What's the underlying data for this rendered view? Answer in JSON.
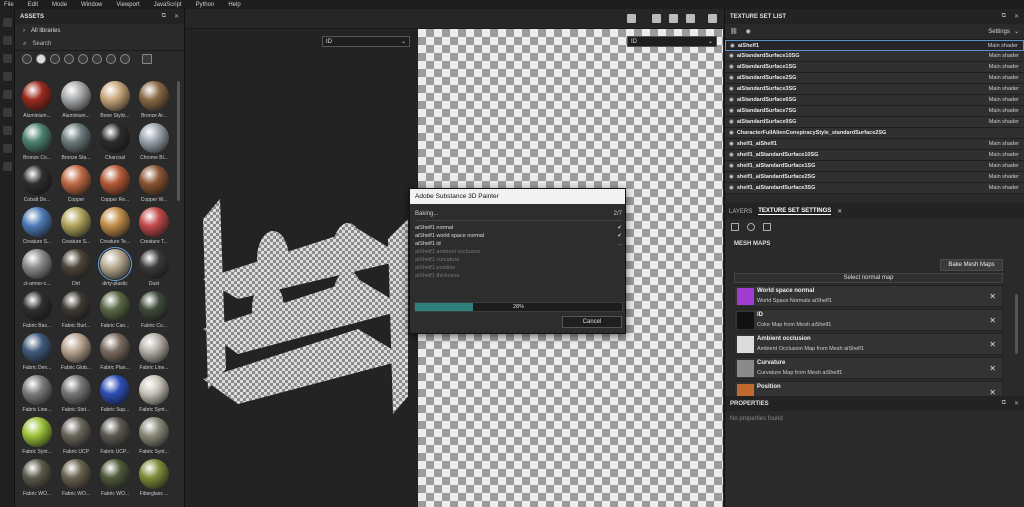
{
  "menubar": [
    "File",
    "Edit",
    "Mode",
    "Window",
    "Viewport",
    "JavaScript",
    "Python",
    "Help"
  ],
  "assets": {
    "title": "ASSETS",
    "tree_label": "All libraries",
    "search_placeholder": "Search",
    "materials": [
      {
        "name": "Aluminium...",
        "color": "#9b2b1d"
      },
      {
        "name": "Aluminium...",
        "color": "#a8aaad"
      },
      {
        "name": "Bone Styliz...",
        "color": "#c9a77b"
      },
      {
        "name": "Bronze Ar...",
        "color": "#8a6a45"
      },
      {
        "name": "Bronze Co...",
        "color": "#4f8270"
      },
      {
        "name": "Bronze Sta...",
        "color": "#6e7b7c"
      },
      {
        "name": "Charcoal",
        "color": "#2c2c2c"
      },
      {
        "name": "Chrome Bl...",
        "color": "#9aa4ad"
      },
      {
        "name": "Cobalt De...",
        "color": "#2e2e2e"
      },
      {
        "name": "Copper",
        "color": "#c06a45"
      },
      {
        "name": "Copper Re...",
        "color": "#b55a36"
      },
      {
        "name": "Copper W...",
        "color": "#8a5633"
      },
      {
        "name": "Creature S...",
        "color": "#4f7cb8"
      },
      {
        "name": "Creature S...",
        "color": "#b1a45c"
      },
      {
        "name": "Creature Te...",
        "color": "#c28d4a"
      },
      {
        "name": "Creature T...",
        "color": "#c24a4a"
      },
      {
        "name": "ct-armor-c...",
        "color": "#8c8c8c"
      },
      {
        "name": "Dirt",
        "color": "#4c4438"
      },
      {
        "name": "dirty-plastic",
        "color": "#b9ab92"
      },
      {
        "name": "Dust",
        "color": "#3a3a3a"
      },
      {
        "name": "Fabric Bas...",
        "color": "#2f2f2f"
      },
      {
        "name": "Fabric Burl...",
        "color": "#3e3a33"
      },
      {
        "name": "Fabric Can...",
        "color": "#5b6847"
      },
      {
        "name": "Fabric Co...",
        "color": "#3f4a3a"
      },
      {
        "name": "Fabric Den...",
        "color": "#3f5a7c"
      },
      {
        "name": "Fabric Glob...",
        "color": "#b8a48f"
      },
      {
        "name": "Fabric Plan...",
        "color": "#7a6a5f"
      },
      {
        "name": "Fabric Line...",
        "color": "#b5b0a7"
      },
      {
        "name": "Fabric Line...",
        "color": "#7d7d7d"
      },
      {
        "name": "Fabric Stet...",
        "color": "#777777"
      },
      {
        "name": "Fabric Sup...",
        "color": "#2f4fb8"
      },
      {
        "name": "Fabric Synt...",
        "color": "#c9c4ba"
      },
      {
        "name": "Fabric Synt...",
        "color": "#9cc33a"
      },
      {
        "name": "Fabric UCP",
        "color": "#6a665c"
      },
      {
        "name": "Fabric UCP...",
        "color": "#5d5a52"
      },
      {
        "name": "Fabric Synt...",
        "color": "#8a8a7a"
      },
      {
        "name": "Fabric WO...",
        "color": "#5b5a4a"
      },
      {
        "name": "Fabric WO...",
        "color": "#6b6350"
      },
      {
        "name": "Fabric WO...",
        "color": "#4f5a3a"
      },
      {
        "name": "Fiberglass ...",
        "color": "#7f8c3a"
      }
    ],
    "selected_index": 18
  },
  "viewport": {
    "dropdown_left": "ID",
    "dropdown_right": "ID"
  },
  "bake_dialog": {
    "title": "Adobe Substance 3D Painter",
    "status": "Baking...",
    "step": "2/7",
    "items": [
      {
        "label": "aiShelf1 normal",
        "state": "✔",
        "done": true
      },
      {
        "label": "aiShelf1 world space normal",
        "state": "✔",
        "done": true
      },
      {
        "label": "aiShelf1 id",
        "state": "...",
        "done": true
      },
      {
        "label": "aiShelf1 ambient occlusion",
        "state": "",
        "done": false
      },
      {
        "label": "aiShelf1 curvature",
        "state": "",
        "done": false
      },
      {
        "label": "aiShelf1 position",
        "state": "",
        "done": false
      },
      {
        "label": "aiShelf1 thickness",
        "state": "",
        "done": false
      }
    ],
    "progress": 28,
    "progress_text": "28%",
    "cancel": "Cancel"
  },
  "texture_set_list": {
    "title": "TEXTURE SET LIST",
    "settings": "Settings",
    "rows": [
      {
        "name": "aiShelf1",
        "shader": "Main shader",
        "selected": true
      },
      {
        "name": "aiStandardSurface10SG",
        "shader": "Main shader"
      },
      {
        "name": "aiStandardSurface1SG",
        "shader": "Main shader"
      },
      {
        "name": "aiStandardSurface2SG",
        "shader": "Main shader"
      },
      {
        "name": "aiStandardSurface3SG",
        "shader": "Main shader"
      },
      {
        "name": "aiStandardSurface6SG",
        "shader": "Main shader"
      },
      {
        "name": "aiStandardSurface7SG",
        "shader": "Main shader"
      },
      {
        "name": "aiStandardSurface9SG",
        "shader": "Main shader"
      },
      {
        "name": "CharacterFullAlienConspiracyStyle_standardSurface2SG",
        "shader": ""
      },
      {
        "name": "shelf1_aiShelf1",
        "shader": "Main shader"
      },
      {
        "name": "shelf1_aiStandardSurface10SG",
        "shader": "Main shader"
      },
      {
        "name": "shelf1_aiStandardSurface1SG",
        "shader": "Main shader"
      },
      {
        "name": "shelf1_aiStandardSurface2SG",
        "shader": "Main shader"
      },
      {
        "name": "shelf1_aiStandardSurface3SG",
        "shader": "Main shader"
      }
    ]
  },
  "texture_set_settings": {
    "tab_layers": "LAYERS",
    "tab_settings": "TEXTURE SET SETTINGS",
    "mesh_maps_title": "MESH MAPS",
    "bake_button": "Bake Mesh Maps",
    "select_normal": "Select normal map",
    "maps": [
      {
        "title": "World space normal",
        "desc": "World Space Normals aiShelf1",
        "thumb": "#a03ccf"
      },
      {
        "title": "ID",
        "desc": "Color Map from Mesh aiShelf1",
        "thumb": "#111111"
      },
      {
        "title": "Ambient occlusion",
        "desc": "Ambient Occlusion Map from Mesh aiShelf1",
        "thumb": "#dcdcdc"
      },
      {
        "title": "Curvature",
        "desc": "Curvature Map from Mesh aiShelf1",
        "thumb": "#8a8a8a"
      },
      {
        "title": "Position",
        "desc": "",
        "thumb": "#c06a30"
      }
    ]
  },
  "properties": {
    "title": "PROPERTIES",
    "empty": "No properties found"
  }
}
